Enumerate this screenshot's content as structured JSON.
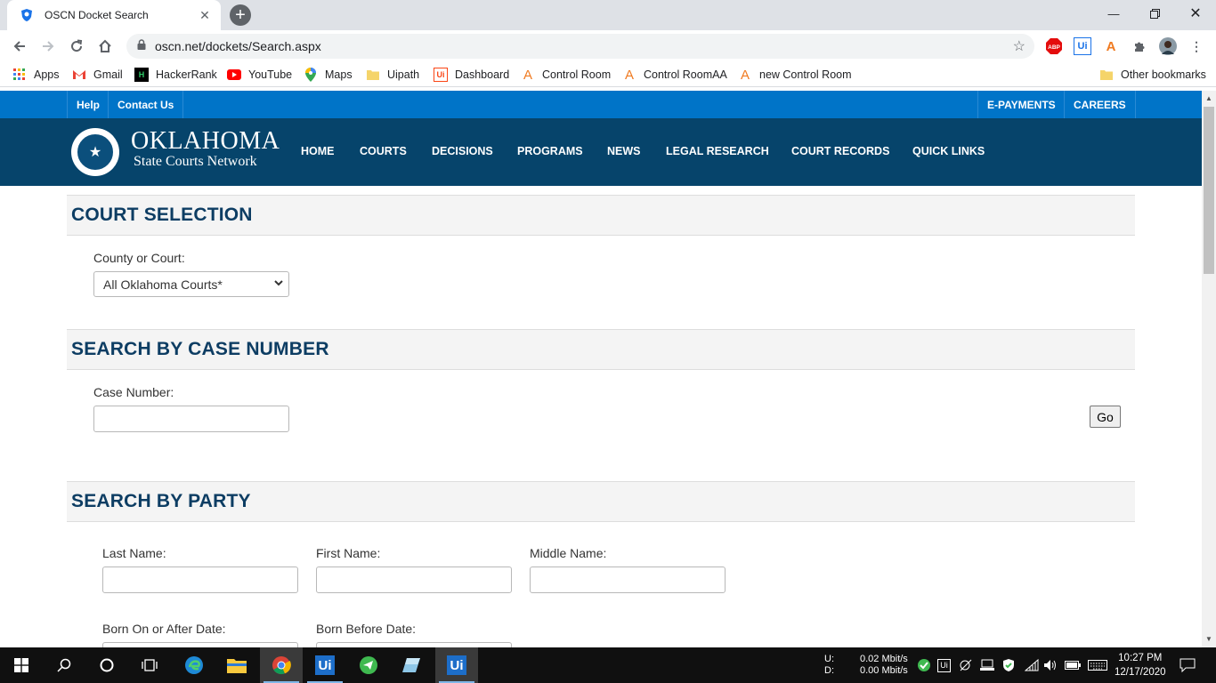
{
  "browser": {
    "tab_title": "OSCN Docket Search",
    "url": "oscn.net/dockets/Search.aspx",
    "bookmarks": [
      "Apps",
      "Gmail",
      "HackerRank",
      "YouTube",
      "Maps",
      "Uipath",
      "Dashboard",
      "Control Room",
      "Control RoomAA",
      "new Control Room"
    ],
    "other_bookmarks": "Other bookmarks",
    "extensions": [
      "ABP",
      "Ui"
    ]
  },
  "site": {
    "utility_left": [
      "Help",
      "Contact Us"
    ],
    "utility_right": [
      "E-PAYMENTS",
      "CAREERS"
    ],
    "brand_line1": "OKLAHOMA",
    "brand_line2": "State Courts Network",
    "nav": [
      "HOME",
      "COURTS",
      "DECISIONS",
      "PROGRAMS",
      "NEWS",
      "LEGAL RESEARCH",
      "COURT RECORDS",
      "QUICK LINKS"
    ]
  },
  "court_selection": {
    "heading": "COURT SELECTION",
    "label": "County or Court:",
    "selected": "All Oklahoma Courts*"
  },
  "case_number": {
    "heading": "SEARCH BY CASE NUMBER",
    "label": "Case Number:",
    "value": "",
    "go": "Go"
  },
  "party": {
    "heading": "SEARCH BY PARTY",
    "last_name": "Last Name:",
    "first_name": "First Name:",
    "middle_name": "Middle Name:",
    "born_after": "Born On or After Date:",
    "born_before": "Born Before Date:"
  },
  "taskbar": {
    "net_up_label": "U:",
    "net_down_label": "D:",
    "net_up": "0.02 Mbit/s",
    "net_down": "0.00 Mbit/s",
    "time": "10:27 PM",
    "date": "12/17/2020",
    "pinned_ui_1": "Ui",
    "pinned_ui_2": "Ui"
  },
  "colors": {
    "topbar": "#0074c8",
    "masthead": "#06446b",
    "heading": "#0d3d63"
  }
}
